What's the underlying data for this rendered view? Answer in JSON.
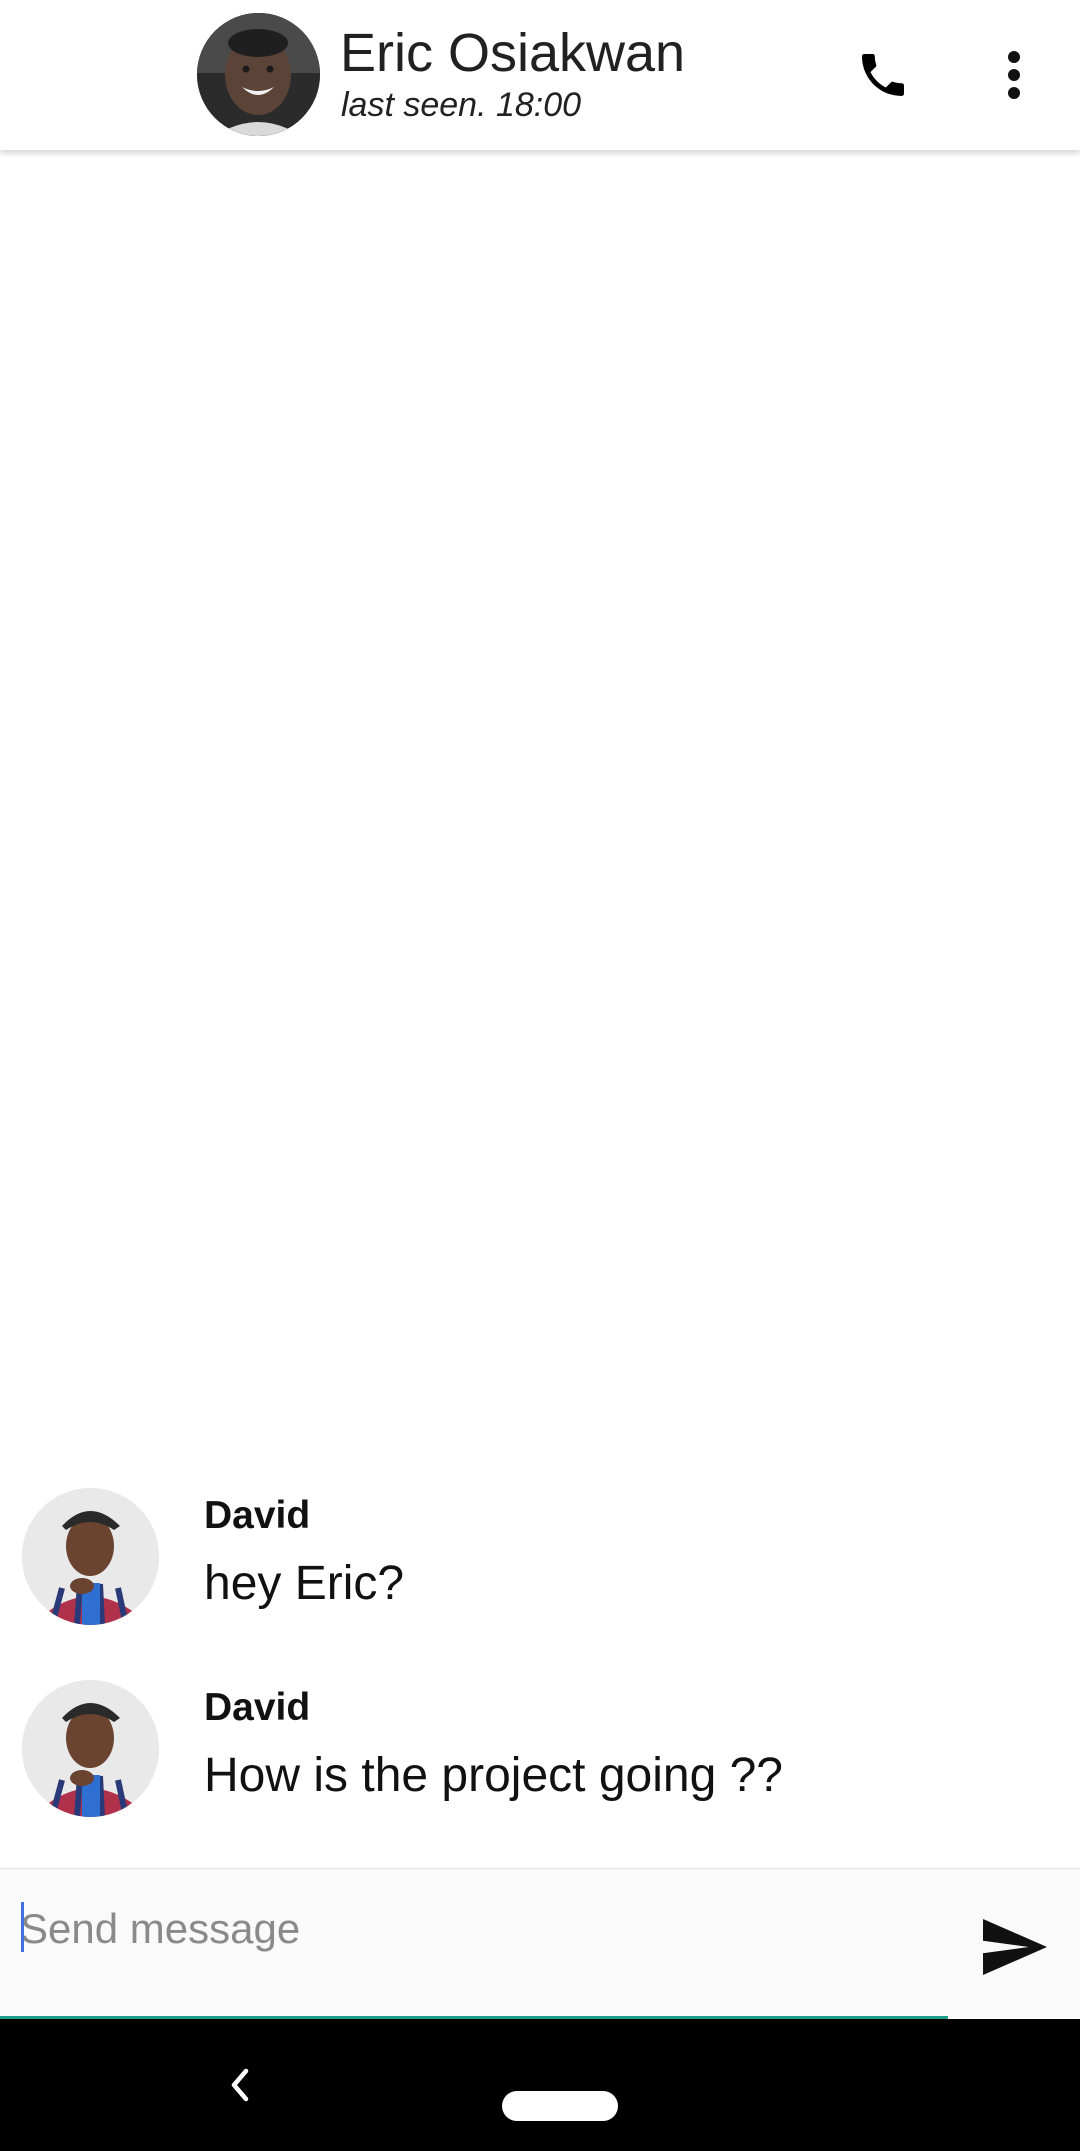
{
  "header": {
    "contact_name": "Eric Osiakwan",
    "status": "last seen. 18:00",
    "avatar_icon": "contact-avatar",
    "call_icon": "phone-icon",
    "menu_icon": "more-vert-icon"
  },
  "messages": [
    {
      "sender": "David",
      "text": "hey Eric?",
      "avatar_icon": "sender-avatar"
    },
    {
      "sender": "David",
      "text": "How is the project going ??",
      "avatar_icon": "sender-avatar"
    }
  ],
  "composer": {
    "placeholder": "Send message",
    "value": "",
    "send_icon": "send-icon"
  },
  "navbar": {
    "back_icon": "chevron-left-icon",
    "home_icon": "home-pill-icon"
  },
  "colors": {
    "accent_underline": "#1a9e8a",
    "cursor": "#3f6fe0",
    "header_bg": "#ffffff",
    "navbar_bg": "#000000"
  }
}
